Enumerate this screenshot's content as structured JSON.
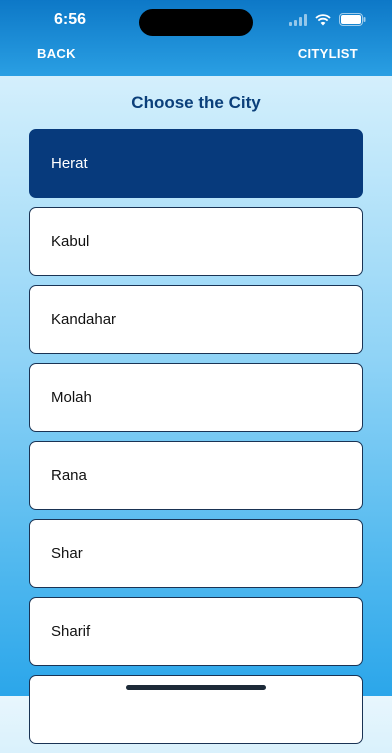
{
  "status": {
    "time": "6:56"
  },
  "nav": {
    "back_label": "BACK",
    "right_label": "CITYLIST"
  },
  "page": {
    "title": "Choose the City"
  },
  "cities": [
    {
      "label": "Herat",
      "selected": true
    },
    {
      "label": "Kabul",
      "selected": false
    },
    {
      "label": "Kandahar",
      "selected": false
    },
    {
      "label": "Molah",
      "selected": false
    },
    {
      "label": "Rana",
      "selected": false
    },
    {
      "label": "Shar",
      "selected": false
    },
    {
      "label": "Sharif",
      "selected": false
    },
    {
      "label": "",
      "selected": false
    }
  ],
  "colors": {
    "nav_bar": "#2a9fe3",
    "title": "#0b3f7a",
    "selected_row": "#073a7c",
    "row_border": "#1a3354"
  },
  "icons": [
    "cellular-icon",
    "wifi-icon",
    "battery-icon"
  ]
}
